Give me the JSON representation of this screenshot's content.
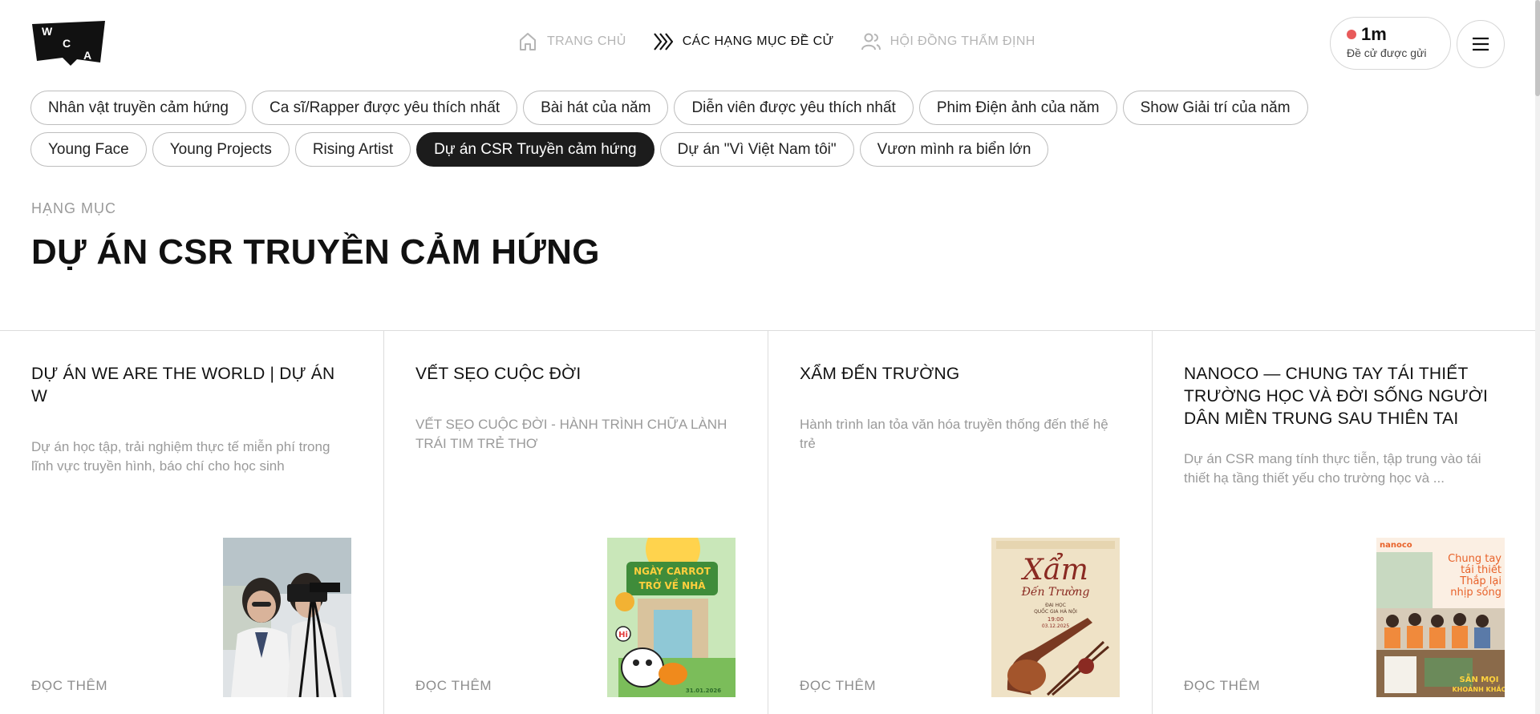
{
  "logo": {
    "letters": [
      "W",
      "C",
      "A"
    ]
  },
  "nav": {
    "items": [
      {
        "label": "TRANG CHỦ",
        "icon": "home-icon"
      },
      {
        "label": "CÁC HẠNG MỤC ĐỀ CỬ",
        "icon": "chevrons-icon"
      },
      {
        "label": "HỘI ĐỒNG THẨM ĐỊNH",
        "icon": "users-icon"
      }
    ]
  },
  "counter": {
    "value": "1m",
    "label": "Đề cử được gửi",
    "dot_color": "#e85a5a"
  },
  "menu": {
    "icon": "hamburger-icon"
  },
  "categories": {
    "row1": [
      "Nhân vật truyền cảm hứng",
      "Ca sĩ/Rapper được yêu thích nhất",
      "Bài hát của năm",
      "Diễn viên được yêu thích nhất",
      "Phim Điện ảnh của năm",
      "Show Giải trí của năm"
    ],
    "row2": [
      "Young Face",
      "Young Projects",
      "Rising Artist",
      "Dự án CSR Truyền cảm hứng",
      "Dự án \"Vì Việt Nam tôi\"",
      "Vươn mình ra biển lớn"
    ],
    "active": "Dự án CSR Truyền cảm hứng"
  },
  "section": {
    "label": "HẠNG MỤC",
    "title": "DỰ ÁN CSR TRUYỀN CẢM HỨNG"
  },
  "cards": [
    {
      "title": "DỰ ÁN WE ARE THE WORLD | DỰ ÁN W",
      "description": "Dự án học tập, trải nghiệm thực tế miễn phí trong lĩnh vực truyền hình, báo chí cho học sinh",
      "more": "ĐỌC THÊM"
    },
    {
      "title": "VẾT SẸO CUỘC ĐỜI",
      "description": "VẾT SẸO CUỘC ĐỜI - HÀNH TRÌNH CHỮA LÀNH TRÁI TIM TRẺ THƠ",
      "more": "ĐỌC THÊM",
      "poster_text": [
        "NGÀY CARROT",
        "TRỞ VỀ NHÀ",
        "Hi",
        "31.01.2026"
      ]
    },
    {
      "title": "XẨM ĐẾN TRƯỜNG",
      "description": "Hành trình lan tỏa văn hóa truyền thống đến thế hệ trẻ",
      "more": "ĐỌC THÊM",
      "poster_text": [
        "Xẩm",
        "Đến Trường",
        "ĐẠI HỌC",
        "QUỐC GIA HÀ NỘI",
        "19:00",
        "03.12.2025"
      ]
    },
    {
      "title": "NANOCO — CHUNG TAY TÁI THIẾT TRƯỜNG HỌC VÀ ĐỜI SỐNG NGƯỜI DÂN MIỀN TRUNG SAU THIÊN TAI",
      "description": "Dự án CSR mang tính thực tiễn, tập trung vào tái thiết hạ tầng thiết yếu cho trường học và ...",
      "more": "ĐỌC THÊM",
      "poster_text": [
        "nanoco",
        "Chung tay",
        "tái thiết",
        "Thắp lại",
        "nhịp sống",
        "SẴN MỌI",
        "KHOẢNH KHẮC"
      ]
    }
  ]
}
